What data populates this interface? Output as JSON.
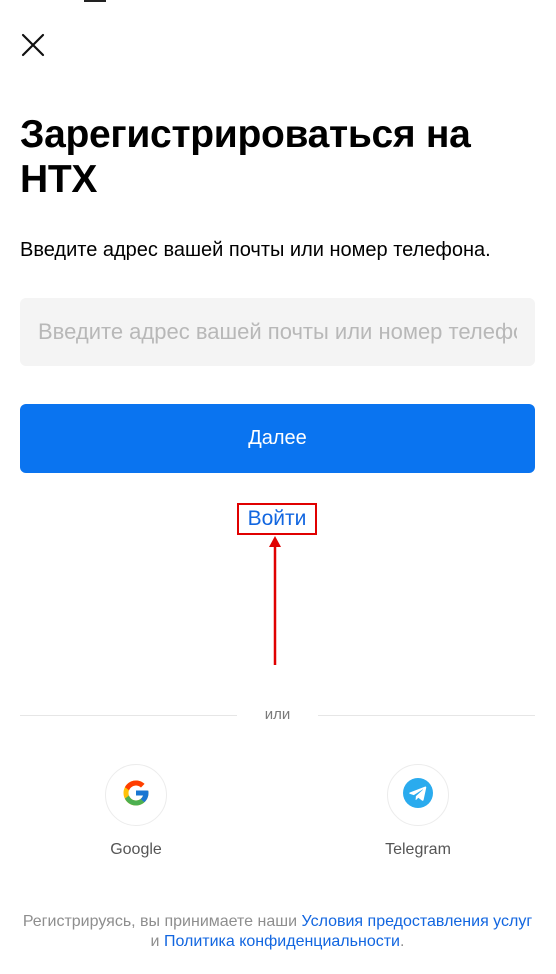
{
  "page": {
    "title": "Зарегистрироваться на HTX",
    "close_icon": "close-icon"
  },
  "form": {
    "field_label": "Введите адрес вашей почты или номер телефона.",
    "input_placeholder": "Введите адрес вашей почты или номер телефона",
    "input_value": "",
    "next_label": "Далее"
  },
  "login": {
    "label": "Войти",
    "highlight_color": "#e00000"
  },
  "divider": {
    "label": "или"
  },
  "social": [
    {
      "name": "Google",
      "icon": "google-icon"
    },
    {
      "name": "Telegram",
      "icon": "telegram-icon"
    }
  ],
  "terms": {
    "prefix": "Регистрируясь, вы принимаете наши ",
    "terms_link": "Условия предоставления услуг",
    "conjunction": " и ",
    "privacy_link": "Политика конфиденциальности",
    "suffix": "."
  },
  "colors": {
    "accent": "#0a74f0",
    "link": "#1266e0",
    "annotation": "#e00000"
  }
}
